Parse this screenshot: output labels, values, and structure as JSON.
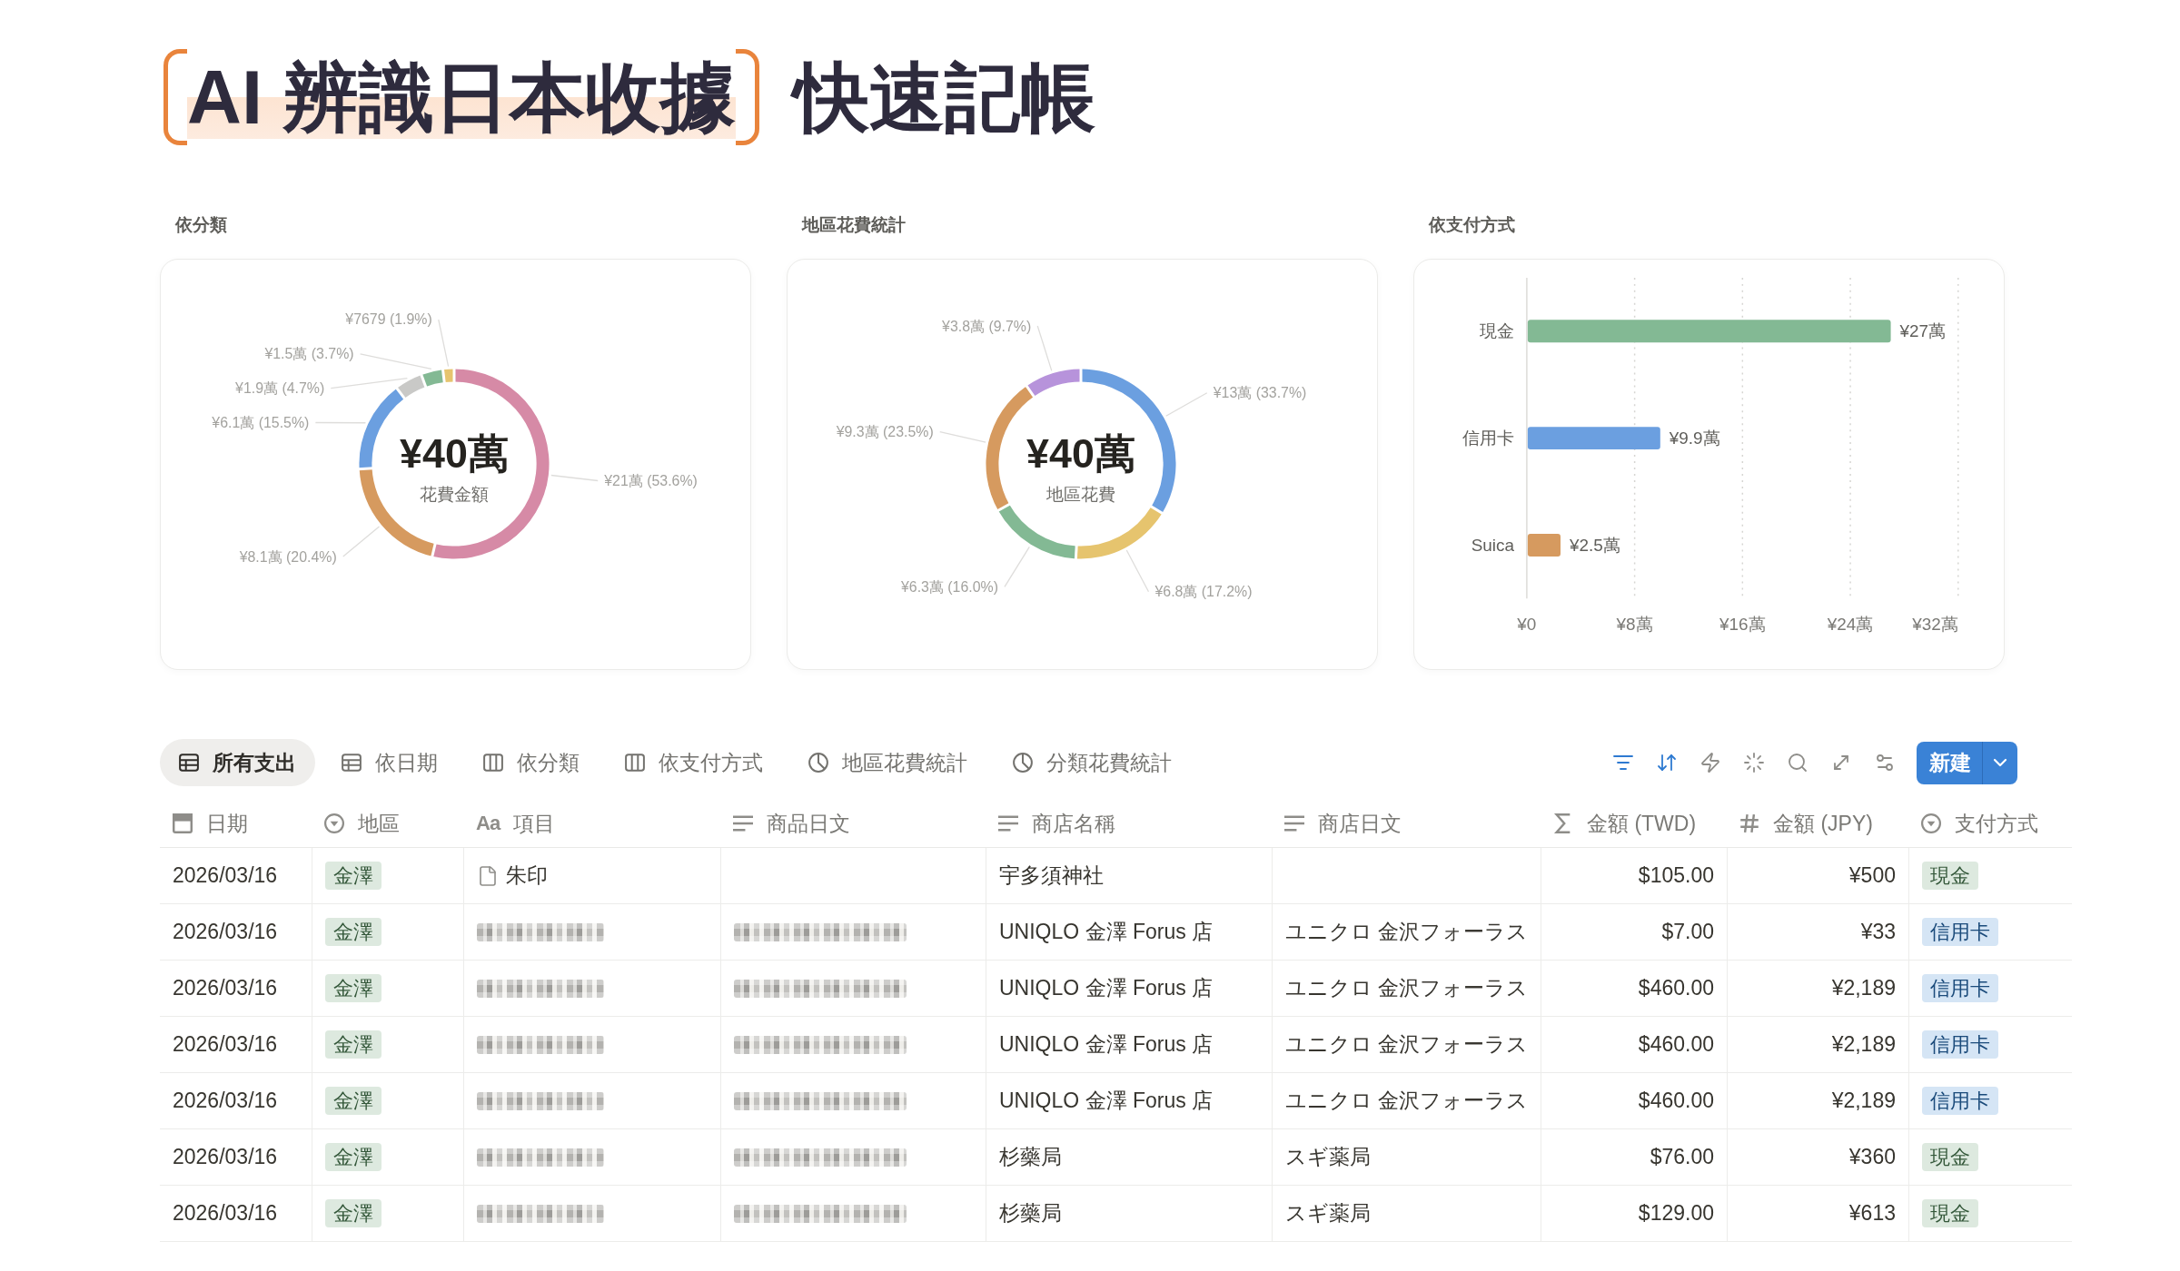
{
  "headline": {
    "highlighted": "AI 辨識日本收據",
    "text": "快速記帳"
  },
  "charts": [
    {
      "center_value": "¥40萬",
      "center_label": "花費金額",
      "chart_data": {
        "type": "donut",
        "title": "依分類",
        "values": [
          53.6,
          20.4,
          15.5,
          4.7,
          3.7,
          1.9
        ],
        "colors": [
          "#d68aa6",
          "#d69a5f",
          "#6b9fe0",
          "#c9c9c7",
          "#83b994",
          "#e6c46e"
        ],
        "value_labels": [
          "¥21萬 (53.6%)",
          "¥8.1萬 (20.4%)",
          "¥6.1萬 (15.5%)",
          "¥1.9萬 (4.7%)",
          "¥1.5萬 (3.7%)",
          "¥7679 (1.9%)"
        ]
      }
    },
    {
      "center_value": "¥40萬",
      "center_label": "地區花費",
      "chart_data": {
        "type": "donut",
        "title": "地區花費統計",
        "values": [
          33.7,
          17.2,
          16.0,
          23.5,
          9.7
        ],
        "colors": [
          "#6b9fe0",
          "#e6c46e",
          "#83b994",
          "#d69a5f",
          "#b793db"
        ],
        "value_labels": [
          "¥13萬 (33.7%)",
          "¥6.8萬 (17.2%)",
          "¥6.3萬 (16.0%)",
          "¥9.3萬 (23.5%)",
          "¥3.8萬 (9.7%)"
        ]
      }
    },
    {
      "chart_data": {
        "type": "bar",
        "orientation": "horizontal",
        "title": "依支付方式",
        "grid": true,
        "categories": [
          "現金",
          "信用卡",
          "Suica"
        ],
        "values": [
          27,
          9.9,
          2.5
        ],
        "colors": [
          "#83b994",
          "#6b9fe0",
          "#d69a5f"
        ],
        "value_labels": [
          "¥27萬",
          "¥9.9萬",
          "¥2.5萬"
        ],
        "xlim": [
          0,
          32
        ],
        "xticks": [
          {
            "value": 0,
            "label": "¥0"
          },
          {
            "value": 8,
            "label": "¥8萬"
          },
          {
            "value": 16,
            "label": "¥16萬"
          },
          {
            "value": 24,
            "label": "¥24萬"
          },
          {
            "value": 32,
            "label": "¥32萬"
          }
        ]
      }
    }
  ],
  "views": {
    "tabs": [
      {
        "label": "所有支出",
        "kind": "table",
        "selected": true
      },
      {
        "label": "依日期",
        "kind": "table",
        "selected": false
      },
      {
        "label": "依分類",
        "kind": "board",
        "selected": false
      },
      {
        "label": "依支付方式",
        "kind": "board",
        "selected": false
      },
      {
        "label": "地區花費統計",
        "kind": "chart",
        "selected": false
      },
      {
        "label": "分類花費統計",
        "kind": "chart",
        "selected": false
      }
    ]
  },
  "toolbar": {
    "tools": [
      {
        "kind": "filter",
        "active": true
      },
      {
        "kind": "sort",
        "active": true
      },
      {
        "kind": "automation",
        "active": false
      },
      {
        "kind": "ai",
        "active": false
      },
      {
        "kind": "search",
        "active": false
      },
      {
        "kind": "expand",
        "active": false
      },
      {
        "kind": "settings",
        "active": false
      }
    ],
    "new_button": {
      "label": "新建"
    }
  },
  "table": {
    "columns": [
      {
        "label": "日期",
        "kind": "date"
      },
      {
        "label": "地區",
        "kind": "select"
      },
      {
        "label": "項目",
        "kind": "title",
        "icon_text": "Aa"
      },
      {
        "label": "商品日文",
        "kind": "text"
      },
      {
        "label": "商店名稱",
        "kind": "text"
      },
      {
        "label": "商店日文",
        "kind": "text"
      },
      {
        "label": "金額 (TWD)",
        "kind": "formula"
      },
      {
        "label": "金額 (JPY)",
        "kind": "number"
      },
      {
        "label": "支付方式",
        "kind": "select"
      }
    ],
    "rows": [
      {
        "date": "2026/03/16",
        "region": {
          "text": "金澤",
          "color": "#dde9df"
        },
        "item": {
          "text": "朱印",
          "blurred": false
        },
        "shop": "宇多須神社",
        "amount_twd": "$105.00",
        "amount_jpy": "¥500",
        "payment": {
          "text": "現金",
          "color": "#dde9df"
        }
      },
      {
        "date": "2026/03/16",
        "region": {
          "text": "金澤",
          "color": "#dde9df"
        },
        "item": {
          "blurred": true
        },
        "item_ja": {
          "blurred": true
        },
        "shop": "UNIQLO 金澤 Forus 店",
        "shop_ja": "ユニクロ 金沢フォーラス",
        "amount_twd": "$7.00",
        "amount_jpy": "¥33",
        "payment": {
          "text": "信用卡",
          "color": "#d5e5f5"
        }
      },
      {
        "date": "2026/03/16",
        "region": {
          "text": "金澤",
          "color": "#dde9df"
        },
        "item": {
          "blurred": true
        },
        "item_ja": {
          "blurred": true
        },
        "shop": "UNIQLO 金澤 Forus 店",
        "shop_ja": "ユニクロ 金沢フォーラス",
        "amount_twd": "$460.00",
        "amount_jpy": "¥2,189",
        "payment": {
          "text": "信用卡",
          "color": "#d5e5f5"
        }
      },
      {
        "date": "2026/03/16",
        "region": {
          "text": "金澤",
          "color": "#dde9df"
        },
        "item": {
          "blurred": true
        },
        "item_ja": {
          "blurred": true
        },
        "shop": "UNIQLO 金澤 Forus 店",
        "shop_ja": "ユニクロ 金沢フォーラス",
        "amount_twd": "$460.00",
        "amount_jpy": "¥2,189",
        "payment": {
          "text": "信用卡",
          "color": "#d5e5f5"
        }
      },
      {
        "date": "2026/03/16",
        "region": {
          "text": "金澤",
          "color": "#dde9df"
        },
        "item": {
          "blurred": true
        },
        "item_ja": {
          "blurred": true
        },
        "shop": "UNIQLO 金澤 Forus 店",
        "shop_ja": "ユニクロ 金沢フォーラス",
        "amount_twd": "$460.00",
        "amount_jpy": "¥2,189",
        "payment": {
          "text": "信用卡",
          "color": "#d5e5f5"
        }
      },
      {
        "date": "2026/03/16",
        "region": {
          "text": "金澤",
          "color": "#dde9df"
        },
        "item": {
          "blurred": true
        },
        "item_ja": {
          "blurred": true
        },
        "shop": "杉藥局",
        "shop_ja": "スギ薬局",
        "amount_twd": "$76.00",
        "amount_jpy": "¥360",
        "payment": {
          "text": "現金",
          "color": "#dde9df"
        }
      },
      {
        "date": "2026/03/16",
        "region": {
          "text": "金澤",
          "color": "#dde9df"
        },
        "item": {
          "blurred": true
        },
        "item_ja": {
          "blurred": true
        },
        "shop": "杉藥局",
        "shop_ja": "スギ薬局",
        "amount_twd": "$129.00",
        "amount_jpy": "¥613",
        "payment": {
          "text": "現金",
          "color": "#dde9df"
        }
      }
    ]
  }
}
